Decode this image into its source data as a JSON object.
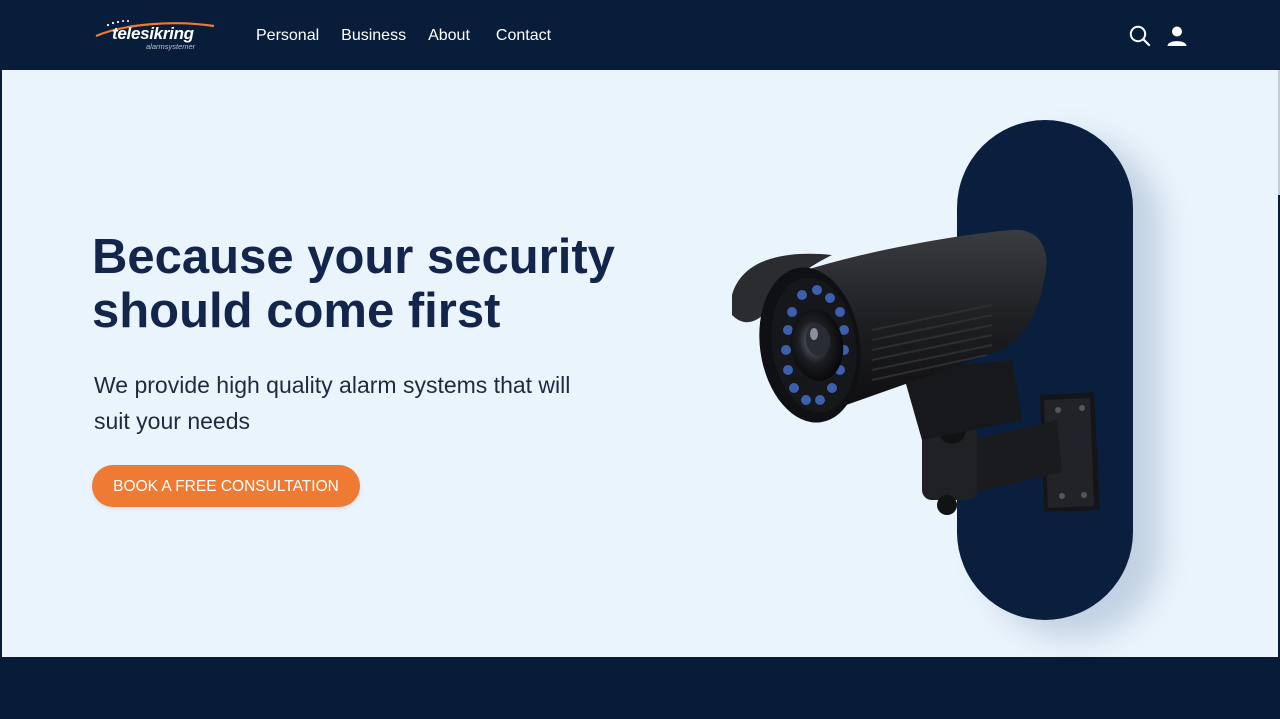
{
  "brand": {
    "name": "telesikring",
    "tagline": "alarmsystemer",
    "navy": "#071d3a",
    "accent": "#ee7a33",
    "hero_bg": "#eaf4fc"
  },
  "nav": {
    "items": [
      {
        "label": "Personal"
      },
      {
        "label": "Business"
      },
      {
        "label": "About"
      },
      {
        "label": "Contact"
      }
    ],
    "icons": [
      "search-icon",
      "user-icon"
    ]
  },
  "hero": {
    "headline": "Because your security should come first",
    "subline": "We provide high quality alarm systems that will suit your needs",
    "cta_label": "BOOK A FREE CONSULTATION",
    "image": "security-camera"
  }
}
